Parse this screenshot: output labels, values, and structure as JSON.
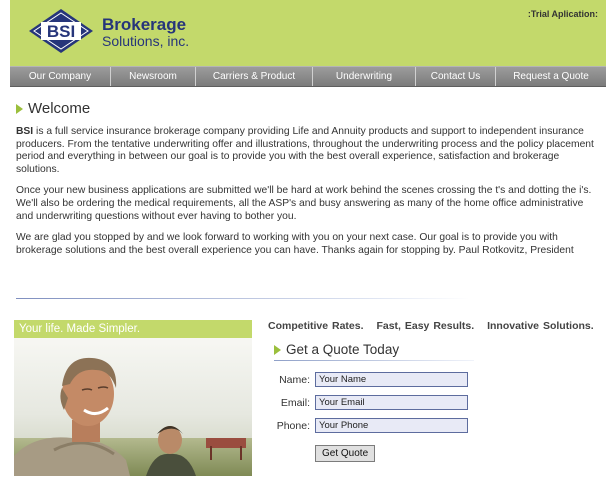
{
  "header": {
    "logo_text": "BSI",
    "brand_line1": "Brokerage",
    "brand_line2": "Solutions, inc.",
    "trial_text": ":Trial Aplication:"
  },
  "nav": {
    "items": [
      {
        "label": "Our Company"
      },
      {
        "label": "Newsroom"
      },
      {
        "label": "Carriers & Product"
      },
      {
        "label": "Underwriting"
      },
      {
        "label": "Contact Us"
      },
      {
        "label": "Request a Quote"
      }
    ]
  },
  "welcome": {
    "title": "Welcome",
    "p1_lead": "BSI",
    "p1_rest": " is a full service insurance brokerage company providing Life and Annuity products and support to independent insurance producers.  From the tentative underwriting offer and  illustrations, throughout the underwriting process and the policy placement period and everything in between our goal is to provide you with the best overall experience, satisfaction and brokerage solutions.",
    "p2": "Once your new business applications are submitted we'll be hard at work behind the scenes crossing the t's and dotting the i's.  We'll also be ordering the medical requirements, all the ASP's and busy answering as many of the home office administrative and underwriting questions without ever having to bother you.",
    "p3": "We are glad you stopped by and we look forward to working with you on your next case.  Our goal is to provide you with brokerage solutions and the best overall experience you can have.  Thanks again for stopping by.  Paul Rotkovitz, President"
  },
  "promo": {
    "caption": "Your life. Made Simpler."
  },
  "taglines": [
    "Competitive Rates.",
    "Fast, Easy Results.",
    "Innovative Solutions."
  ],
  "quote": {
    "title": "Get a Quote Today",
    "name_label": "Name:",
    "name_value": "Your Name",
    "email_label": "Email:",
    "email_value": "Your Email",
    "phone_label": "Phone:",
    "phone_value": "Your Phone",
    "submit_label": "Get Quote"
  },
  "colors": {
    "header_green": "#c3d96b",
    "brand_navy": "#26357a",
    "nav_gray": "#8a8a8a",
    "bullet_green": "#9bbf3c"
  }
}
